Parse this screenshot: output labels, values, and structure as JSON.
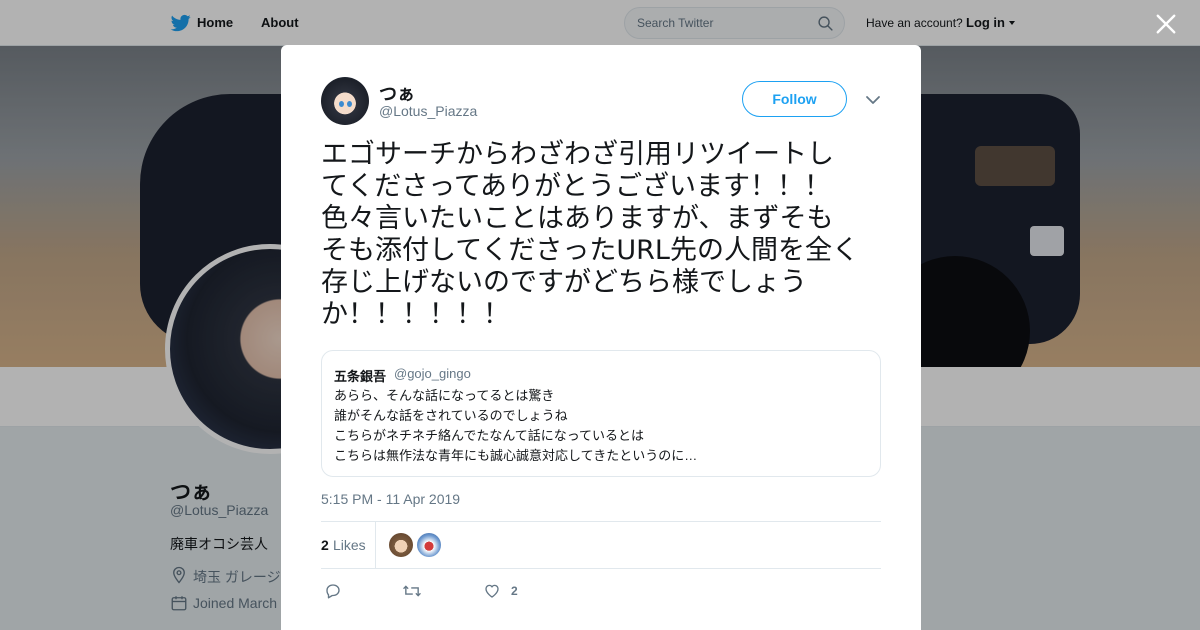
{
  "nav": {
    "home_label": "Home",
    "about_label": "About",
    "search_placeholder": "Search Twitter",
    "account_prompt": "Have an account?",
    "login_label": "Log in"
  },
  "profile": {
    "name": "つぁ",
    "handle": "@Lotus_Piazza",
    "bio": "廃車オコシ芸人",
    "location": "埼玉 ガレージ",
    "joined": "Joined March"
  },
  "tweet": {
    "author_name": "つぁ",
    "author_handle": "@Lotus_Piazza",
    "follow_label": "Follow",
    "text_lines": [
      "エゴサーチからわざわざ引用リツイートし",
      "てくださってありがとうございます！！！",
      "色々言いたいことはありますが、まずそも",
      "そも添付してくださったURL先の人間を全く",
      "存じ上げないのですがどちら様でしょう",
      "か！！！！！！"
    ],
    "quoted": {
      "name": "五条銀吾",
      "handle": "@gojo_gingo",
      "lines": [
        "あらら、そんな話になってるとは驚き",
        "誰がそんな話をされているのでしょうね",
        "こちらがネチネチ絡んでたなんて話になっているとは",
        "こちらは無作法な青年にも誠心誠意対応してきたというのに…"
      ]
    },
    "timestamp": "5:15 PM - 11 Apr 2019",
    "likes_count": "2",
    "likes_label": "Likes",
    "action_like_count": "2"
  },
  "colors": {
    "accent": "#1da1f2",
    "muted": "#657786",
    "text": "#14171a",
    "border": "#e1e8ed"
  },
  "icons": [
    "twitter-bird-icon",
    "search-icon",
    "close-icon",
    "chevron-down-icon",
    "location-pin-icon",
    "calendar-icon",
    "reply-icon",
    "retweet-icon",
    "heart-icon"
  ]
}
